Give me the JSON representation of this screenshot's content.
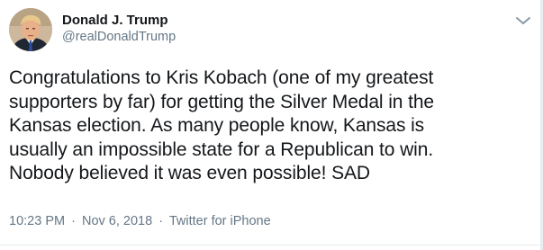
{
  "author": {
    "display_name": "Donald J. Trump",
    "handle": "@realDonaldTrump",
    "avatar_icon": "profile-photo"
  },
  "menu": {
    "icon": "chevron-down-icon",
    "color": "#8899a6"
  },
  "tweet": {
    "lines": [
      "Congratulations to Kris Kobach (one of my greatest",
      "supporters by far) for getting the Silver Medal in the",
      "Kansas election. As many people know, Kansas is",
      "usually an impossible state for a Republican to win.",
      "Nobody believed it was even possible! SAD"
    ]
  },
  "meta": {
    "time": "10:23 PM",
    "separator": "·",
    "date": "Nov 6, 2018",
    "source": "Twitter for iPhone"
  },
  "colors": {
    "text": "#14171a",
    "secondary": "#657786",
    "divider": "#e6ecf0"
  }
}
